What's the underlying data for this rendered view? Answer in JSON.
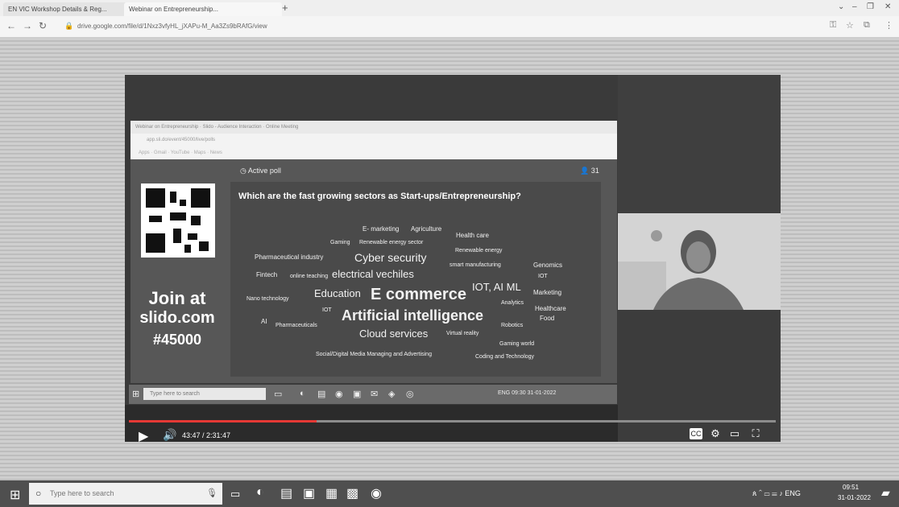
{
  "browser": {
    "tabs": [
      {
        "title": "EN VIC Workshop Details & Reg..."
      },
      {
        "title": "Webinar on Entrepreneurship..."
      }
    ],
    "new_tab": "+",
    "url": "drive.google.com/file/d/1Nxz3vfyHL_jXAPu-M_Aa3Zs9bRAfG/view",
    "window_controls": [
      "⌄",
      "–",
      "❐",
      "✕"
    ]
  },
  "inner_browser": {
    "tabs_text": "Webinar on Entrepreneurship · Slido - Audience Interaction · Online Meeting",
    "address_text": "app.sli.do/event/45000/live/polls",
    "bookmarks_text": "Apps · Gmail · YouTube · Maps · News"
  },
  "slide": {
    "join": [
      "Join at",
      "slido.com",
      "#45000"
    ],
    "active_poll": "Active poll",
    "count": "31",
    "question": "Which are the fast growing sectors as Start-ups/Entrepreneurship?",
    "words": {
      "w1": "E- marketing",
      "w2": "Agriculture",
      "w3": "Health care",
      "w4": "Gaming",
      "w5": "Renewable energy sector",
      "w6": "Renewable energy",
      "w7": "Pharmaceutical industry",
      "w8": "Cyber security",
      "w9": "smart manufacturing",
      "w10": "Genomics",
      "w11": "Fintech",
      "w12": "online teaching",
      "w13": "electrical vechiles",
      "w14": "IOT",
      "w15": "Nano technology",
      "w16": "Education",
      "w17": "E commerce",
      "w18": "IOT, AI ML",
      "w19": "Marketing",
      "w20": "Analytics",
      "w21": "IOT",
      "w22": "Healthcare",
      "w23": "AI",
      "w24": "Pharmaceuticals",
      "w25": "Artificial intelligence",
      "w26": "Robotics",
      "w27": "Food",
      "w28": "Cloud services",
      "w29": "Virtual reality",
      "w30": "Gaming world",
      "w31": "Social/Digital Media Managing and Advertising",
      "w32": "Coding and Technology"
    }
  },
  "inner_taskbar": {
    "search_placeholder": "Type here to search",
    "tray": "ENG 09:30 31-01-2022"
  },
  "player": {
    "time": "43:47 / 2:31:47",
    "progress_fraction": 0.29,
    "controls": {
      "cc": "CC",
      "settings": "⚙",
      "miniplayer": "▭",
      "fullscreen": "⛶"
    }
  },
  "taskbar": {
    "search_placeholder": "Type here to search",
    "lang": "ENG",
    "time": "09:51",
    "date": "31-01-2022"
  }
}
